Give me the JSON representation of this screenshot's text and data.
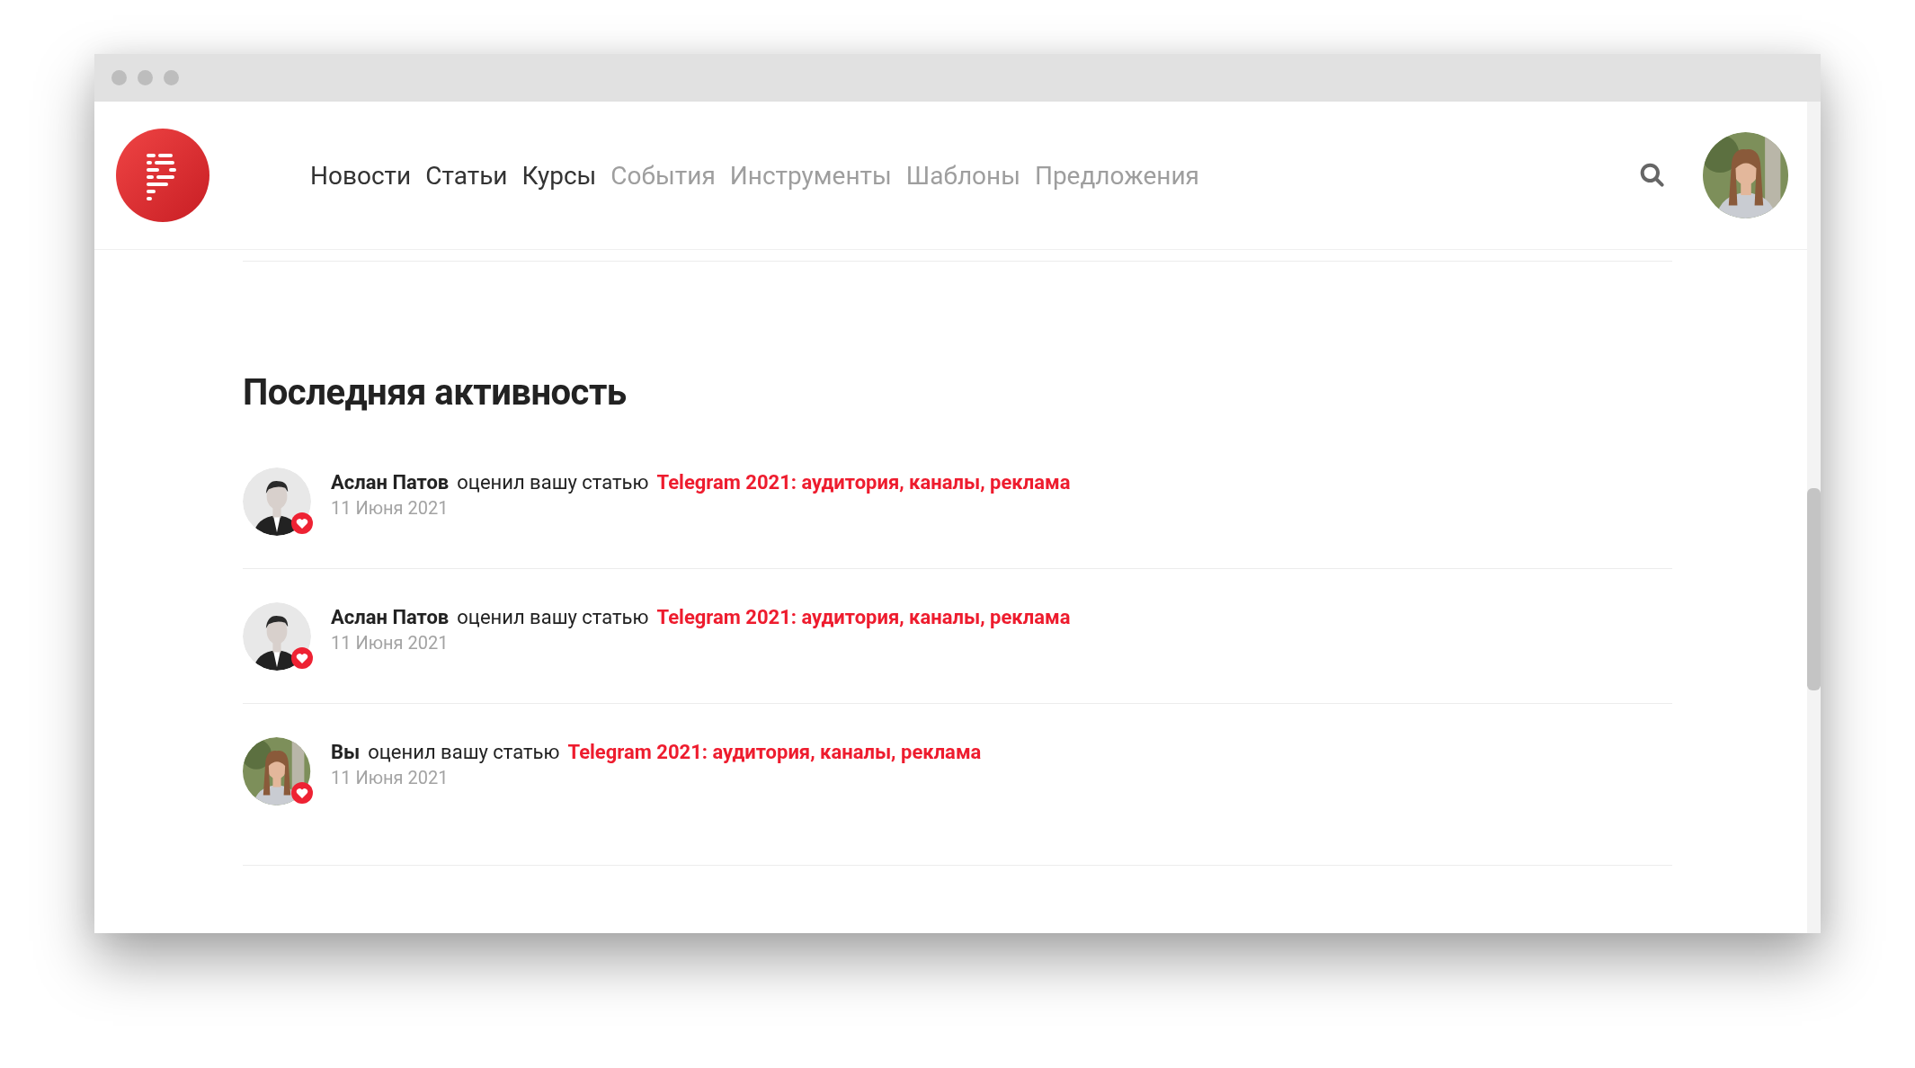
{
  "nav": [
    {
      "label": "Новости",
      "active": true
    },
    {
      "label": "Статьи",
      "active": true
    },
    {
      "label": "Курсы",
      "active": true
    },
    {
      "label": "События",
      "active": false
    },
    {
      "label": "Инструменты",
      "active": false
    },
    {
      "label": "Шаблоны",
      "active": false
    },
    {
      "label": "Предложения",
      "active": false
    }
  ],
  "activity": {
    "title": "Последняя активность",
    "items": [
      {
        "author": "Аслан Патов",
        "action": "оценил вашу статью",
        "article": "Telegram 2021: аудитория, каналы, реклама",
        "date": "11 Июня 2021"
      },
      {
        "author": "Аслан Патов",
        "action": "оценил вашу статью",
        "article": "Telegram 2021: аудитория, каналы, реклама",
        "date": "11 Июня 2021"
      },
      {
        "author": "Вы",
        "action": "оценил вашу статью",
        "article": "Telegram 2021: аудитория, каналы, реклама",
        "date": "11 Июня 2021"
      }
    ]
  }
}
